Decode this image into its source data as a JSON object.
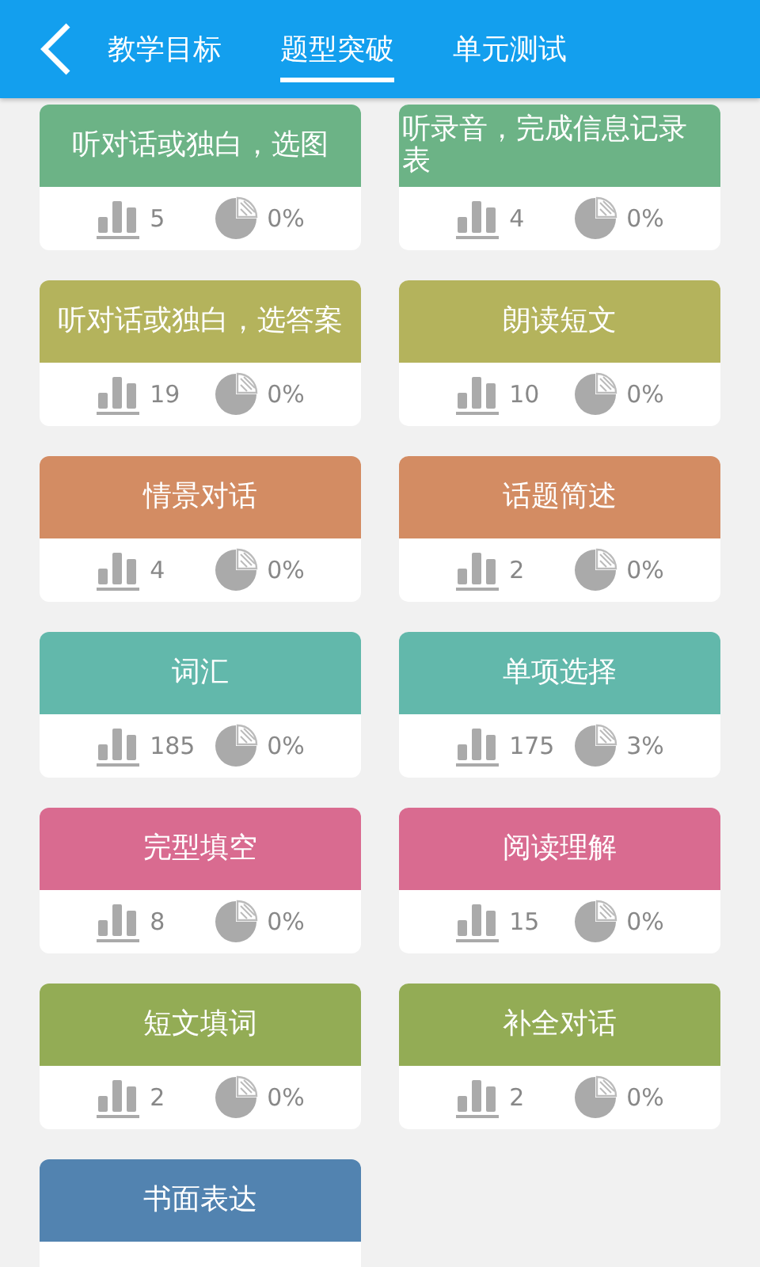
{
  "header": {
    "back": true,
    "tabs": [
      {
        "label": "教学目标",
        "selected": false
      },
      {
        "label": "题型突破",
        "selected": true
      },
      {
        "label": "单元测试",
        "selected": false
      }
    ]
  },
  "cards": [
    {
      "title": "听对话或独白，选图",
      "color": "#6cb386",
      "count": "5",
      "percent": "0%"
    },
    {
      "title": "听录音，完成信息记录表",
      "color": "#6cb386",
      "count": "4",
      "percent": "0%"
    },
    {
      "title": "听对话或独白，选答案",
      "color": "#b4b35c",
      "count": "19",
      "percent": "0%"
    },
    {
      "title": "朗读短文",
      "color": "#b4b35c",
      "count": "10",
      "percent": "0%"
    },
    {
      "title": "情景对话",
      "color": "#d38c63",
      "count": "4",
      "percent": "0%"
    },
    {
      "title": "话题简述",
      "color": "#d38c63",
      "count": "2",
      "percent": "0%"
    },
    {
      "title": "词汇",
      "color": "#62b8ab",
      "count": "185",
      "percent": "0%"
    },
    {
      "title": "单项选择",
      "color": "#62b8ab",
      "count": "175",
      "percent": "3%"
    },
    {
      "title": "完型填空",
      "color": "#d96b90",
      "count": "8",
      "percent": "0%"
    },
    {
      "title": "阅读理解",
      "color": "#d96b90",
      "count": "15",
      "percent": "0%"
    },
    {
      "title": "短文填词",
      "color": "#93ac55",
      "count": "2",
      "percent": "0%"
    },
    {
      "title": "补全对话",
      "color": "#93ac55",
      "count": "2",
      "percent": "0%"
    },
    {
      "title": "书面表达",
      "color": "#5283b0"
    }
  ]
}
